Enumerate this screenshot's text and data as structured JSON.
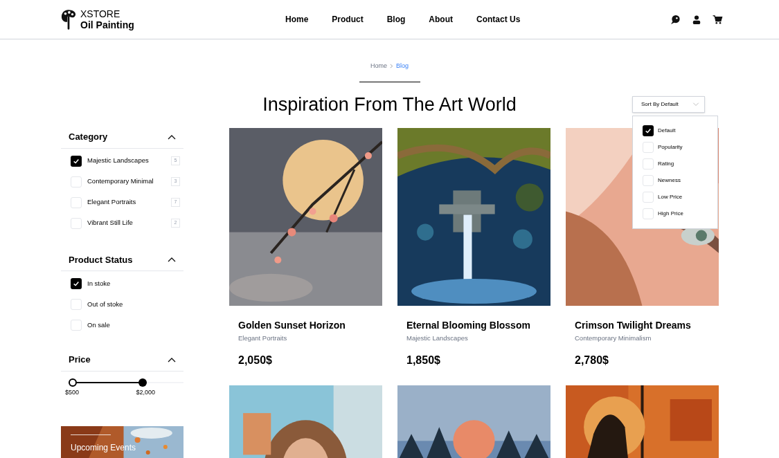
{
  "header": {
    "logo": {
      "line1": "XSTORE",
      "line2": "Oil Painting"
    },
    "nav": [
      {
        "label": "Home"
      },
      {
        "label": "Product"
      },
      {
        "label": "Blog"
      },
      {
        "label": "About"
      },
      {
        "label": "Contact Us"
      }
    ]
  },
  "breadcrumb": [
    {
      "label": "Home",
      "selected": false
    },
    {
      "label": "Blog",
      "selected": true
    }
  ],
  "title": "Inspiration From The Art World",
  "sort": {
    "label": "Sort By Default",
    "expanded": true,
    "options": [
      {
        "label": "Default",
        "checked": true
      },
      {
        "label": "Popularity",
        "checked": false
      },
      {
        "label": "Rating",
        "checked": false
      },
      {
        "label": "Newness",
        "checked": false
      },
      {
        "label": "Low Price",
        "checked": false
      },
      {
        "label": "High Price",
        "checked": false
      }
    ]
  },
  "filters": [
    {
      "title": "Category",
      "expanded": true,
      "items": [
        {
          "label": "Majestic Landscapes",
          "count": "5",
          "checked": true
        },
        {
          "label": "Contemporary Minimal",
          "count": "3",
          "checked": false
        },
        {
          "label": "Elegant Portraits",
          "count": "7",
          "checked": false
        },
        {
          "label": "Vibrant Still Life",
          "count": "2",
          "checked": false
        }
      ]
    },
    {
      "title": "Product Status",
      "expanded": true,
      "items": [
        {
          "label": "In stoke",
          "checked": true
        },
        {
          "label": "Out of stoke",
          "checked": false
        },
        {
          "label": "On sale",
          "checked": false
        }
      ]
    }
  ],
  "price": {
    "title": "Price",
    "expanded": true,
    "thumbs": [
      {
        "level": 0
      },
      {
        "level": 0.65
      }
    ],
    "min_label": "$500",
    "max_label": "$2,000"
  },
  "banner": {
    "kind": "picture",
    "text": "Upcoming Events"
  },
  "products": [
    {
      "kind": "picture",
      "title": "Golden Sunset Horizon",
      "category": "Elegant Portraits",
      "price": "2,050$"
    },
    {
      "kind": "picture",
      "title": "Eternal Blooming Blossom",
      "category": "Majestic Landscapes",
      "price": "1,850$"
    },
    {
      "kind": "picture",
      "title": "Crimson Twilight Dreams",
      "category": "Contemporary Minimalism",
      "price": "2,780$"
    },
    {
      "kind": "picture"
    },
    {
      "kind": "picture"
    },
    {
      "kind": "picture"
    }
  ]
}
